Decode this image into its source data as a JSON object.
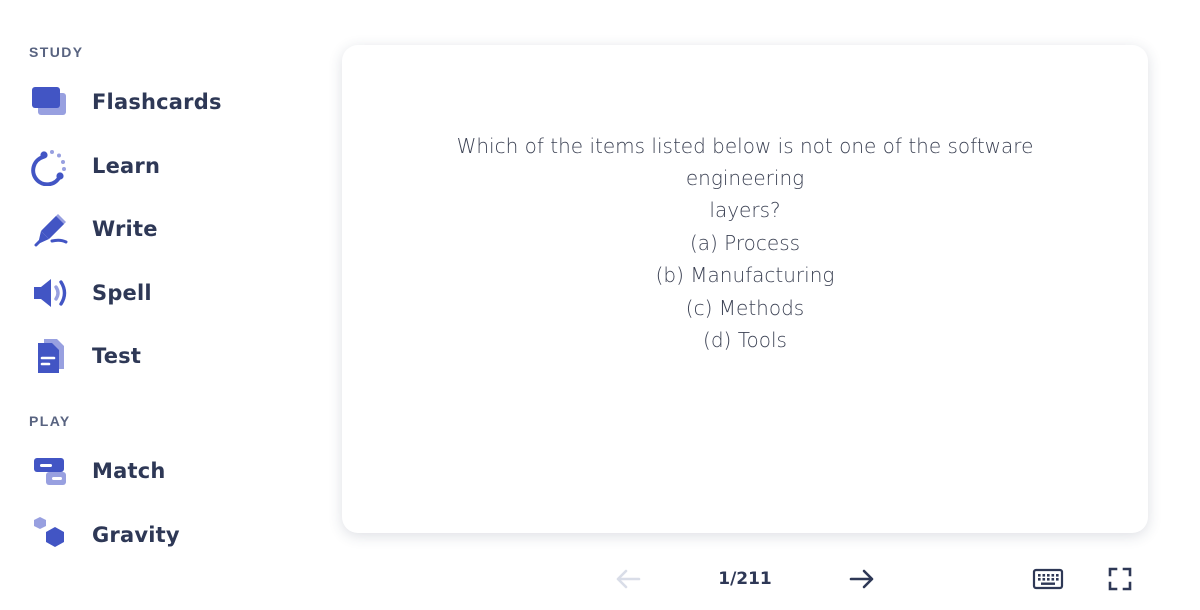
{
  "sidebar": {
    "study_label": "STUDY",
    "play_label": "PLAY",
    "study_items": [
      {
        "label": "Flashcards",
        "icon": "flashcards-icon"
      },
      {
        "label": "Learn",
        "icon": "learn-icon"
      },
      {
        "label": "Write",
        "icon": "write-icon"
      },
      {
        "label": "Spell",
        "icon": "spell-icon"
      },
      {
        "label": "Test",
        "icon": "test-icon"
      }
    ],
    "play_items": [
      {
        "label": "Match",
        "icon": "match-icon"
      },
      {
        "label": "Gravity",
        "icon": "gravity-icon"
      }
    ]
  },
  "card": {
    "lines": [
      "Which of the items listed below is not one of the software engineering",
      "layers?",
      "(a) Process",
      "(b) Manufacturing",
      "(c) Methods",
      "(d) Tools"
    ]
  },
  "controls": {
    "counter": "1/211",
    "prev_icon": "arrow-left-icon",
    "next_icon": "arrow-right-icon",
    "keyboard_icon": "keyboard-icon",
    "fullscreen_icon": "fullscreen-icon"
  },
  "colors": {
    "icon_primary": "#4255c4",
    "icon_secondary": "#98a0e0",
    "text_primary": "#2e3856",
    "text_muted": "#586380",
    "disabled": "#d9dde8"
  }
}
